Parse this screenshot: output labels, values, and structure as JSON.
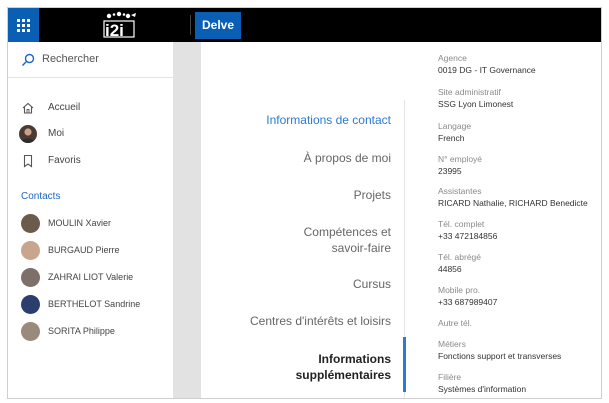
{
  "topbar": {
    "app_name": "Delve",
    "logo_text": "i2i"
  },
  "leftnav": {
    "search_placeholder": "Rechercher",
    "items": [
      {
        "label": "Accueil",
        "icon": "home-icon"
      },
      {
        "label": "Moi",
        "icon": "user-avatar"
      },
      {
        "label": "Favoris",
        "icon": "bookmark-icon"
      }
    ],
    "contacts_title": "Contacts",
    "contacts": [
      {
        "label": "MOULIN Xavier",
        "color": "#6b5b4a"
      },
      {
        "label": "BURGAUD Pierre",
        "color": "#c9a58e"
      },
      {
        "label": "ZAHRAI LIOT Valerie",
        "color": "#7d6f6a"
      },
      {
        "label": "BERTHELOT Sandrine",
        "color": "#2b3f6e"
      },
      {
        "label": "SORITA Philippe",
        "color": "#9a8a7c"
      }
    ]
  },
  "menu": {
    "items": [
      {
        "label": "Informations de contact",
        "state": "active"
      },
      {
        "label": "À propos de moi",
        "state": "normal"
      },
      {
        "label": "Projets",
        "state": "normal"
      },
      {
        "label": "Compétences et savoir-faire",
        "state": "normal"
      },
      {
        "label": "Cursus",
        "state": "normal"
      },
      {
        "label": "Centres d'intérêts et loisirs",
        "state": "normal"
      },
      {
        "label": "Informations supplémentaires",
        "state": "selected"
      }
    ],
    "accent_color": "#2a7bd1"
  },
  "details": [
    {
      "label": "Agence",
      "value": "0019 DG - IT Governance"
    },
    {
      "label": "Site administratif",
      "value": "SSG Lyon Limonest"
    },
    {
      "label": "Langage",
      "value": "French"
    },
    {
      "label": "N° employé",
      "value": "23995"
    },
    {
      "label": "Assistantes",
      "value": "RICARD Nathalie, RICHARD Benedicte"
    },
    {
      "label": "Tél. complet",
      "value": "+33 472184856"
    },
    {
      "label": "Tél. abrégé",
      "value": "44856"
    },
    {
      "label": "Mobile pro.",
      "value": "+33 687989407"
    },
    {
      "label": "Autre tél.",
      "value": ""
    },
    {
      "label": "Métiers",
      "value": "Fonctions support et transverses"
    },
    {
      "label": "Filière",
      "value": "Systèmes d'information"
    }
  ]
}
